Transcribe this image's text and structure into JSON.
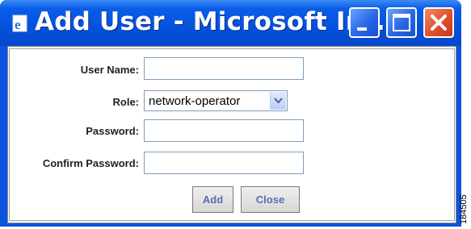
{
  "window": {
    "title": "Add User - Microsoft Int...",
    "icon": "ie-page-icon",
    "controls": [
      "minimize-icon",
      "maximize-icon",
      "close-icon"
    ]
  },
  "form": {
    "username_label": "User Name:",
    "username_value": "",
    "role_label": "Role:",
    "role_selected": "network-operator",
    "password_label": "Password:",
    "password_value": "",
    "confirm_label": "Confirm Password:",
    "confirm_value": ""
  },
  "buttons": {
    "add_label": "Add",
    "close_label": "Close"
  },
  "figure_code": "184505",
  "colors": {
    "titlebar": "#0550dc",
    "close_button": "#e0502b",
    "button_text": "#5b6db3"
  }
}
